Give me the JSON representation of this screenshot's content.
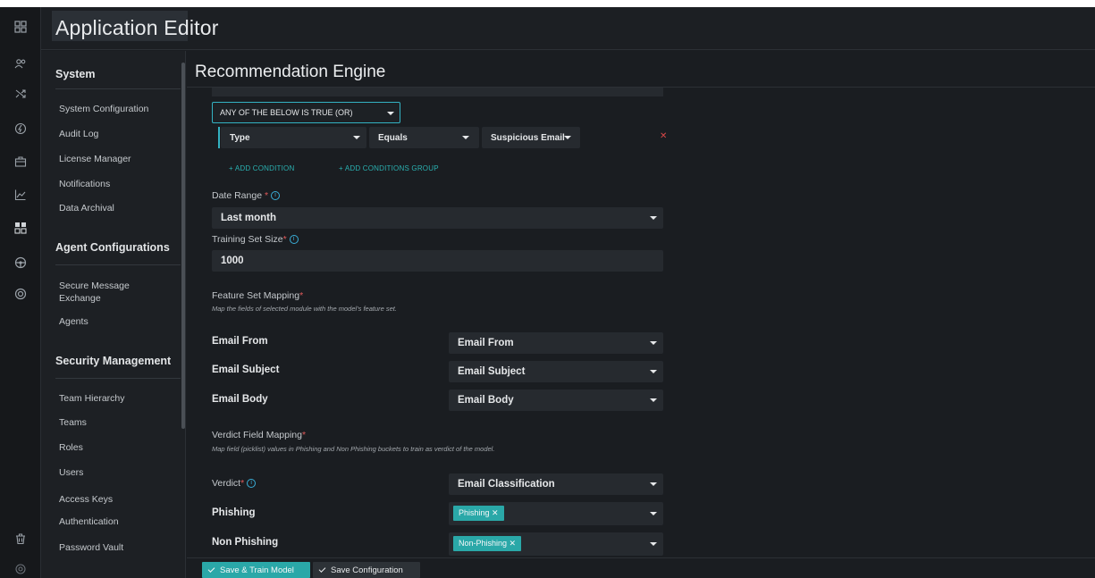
{
  "app": {
    "title": "Application Editor"
  },
  "iconbar": {
    "icons": [
      "dashboard-icon",
      "users-icon",
      "shuffle-icon",
      "bolt-icon",
      "briefcase-icon",
      "chart-icon",
      "apps-icon",
      "steering-icon",
      "support-icon",
      "trash-icon",
      "at-icon"
    ]
  },
  "sidebar": {
    "sections": [
      {
        "title": "System",
        "items": [
          "System Configuration",
          "Audit Log",
          "License Manager",
          "Notifications",
          "Data Archival"
        ]
      },
      {
        "title": "Agent Configurations",
        "items": [
          "Secure Message Exchange",
          "Agents"
        ]
      },
      {
        "title": "Security Management",
        "items": [
          "Team Hierarchy",
          "Teams",
          "Roles",
          "Users",
          "Access Keys",
          "Authentication",
          "Password Vault"
        ]
      }
    ]
  },
  "main": {
    "title": "Recommendation Engine",
    "condition_group": {
      "operator": "ANY OF THE BELOW IS TRUE (OR)",
      "condition": {
        "field": "Type",
        "op": "Equals",
        "value": "Suspicious Email"
      },
      "add_condition": "+ ADD CONDITION",
      "add_group": "+ ADD CONDITIONS GROUP"
    },
    "date_range": {
      "label": "Date Range",
      "value": "Last month"
    },
    "training_set": {
      "label": "Training Set Size",
      "value": "1000"
    },
    "feature_mapping": {
      "label": "Feature Set Mapping",
      "hint": "Map the fields of selected module with the model's feature set.",
      "rows": [
        {
          "label": "Email From",
          "value": "Email From"
        },
        {
          "label": "Email Subject",
          "value": "Email Subject"
        },
        {
          "label": "Email Body",
          "value": "Email Body"
        }
      ]
    },
    "verdict_mapping": {
      "label": "Verdict Field Mapping",
      "hint": "Map field (picklist) values in Phishing and Non Phishing buckets to train as verdict of the model.",
      "verdict": {
        "label": "Verdict",
        "value": "Email Classification"
      },
      "phishing": {
        "label": "Phishing",
        "chip": "Phishing"
      },
      "non_phishing": {
        "label": "Non Phishing",
        "chip": "Non-Phishing"
      }
    }
  },
  "footer": {
    "save_train": "Save & Train Model",
    "save_config": "Save Configuration"
  },
  "colors": {
    "accent": "#2aa8a8",
    "required": "#e05a5a",
    "info": "#3aaed8"
  }
}
